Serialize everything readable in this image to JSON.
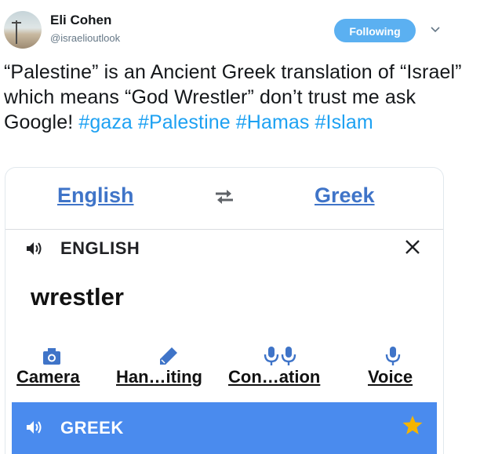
{
  "tweet": {
    "author_name": "Eli Cohen",
    "handle": "@israelioutlook",
    "follow_label": "Following",
    "text_main": "“Palestine” is an Ancient Greek translation of “Israel” which means “God Wrestler” don’t trust me ask Google! ",
    "hashtags": [
      "#gaza",
      "#Palestine",
      "#Hamas",
      "#Islam"
    ]
  },
  "translator": {
    "source_lang": "English",
    "target_lang": "Greek",
    "source_panel_label": "ENGLISH",
    "input_text": "wrestler",
    "tools": [
      {
        "label": "Camera",
        "icon": "camera-icon"
      },
      {
        "label": "Han…iting",
        "icon": "pen-icon"
      },
      {
        "label": "Con…ation",
        "icon": "dual-mic-icon"
      },
      {
        "label": "Voice",
        "icon": "mic-icon"
      }
    ],
    "target_panel_label": "GREEK"
  },
  "colors": {
    "follow_button": "#5bb0f1",
    "hashtag": "#1da1f2",
    "lang_link": "#3f74c8",
    "output_panel": "#4a8bee",
    "star": "#f4b400"
  }
}
